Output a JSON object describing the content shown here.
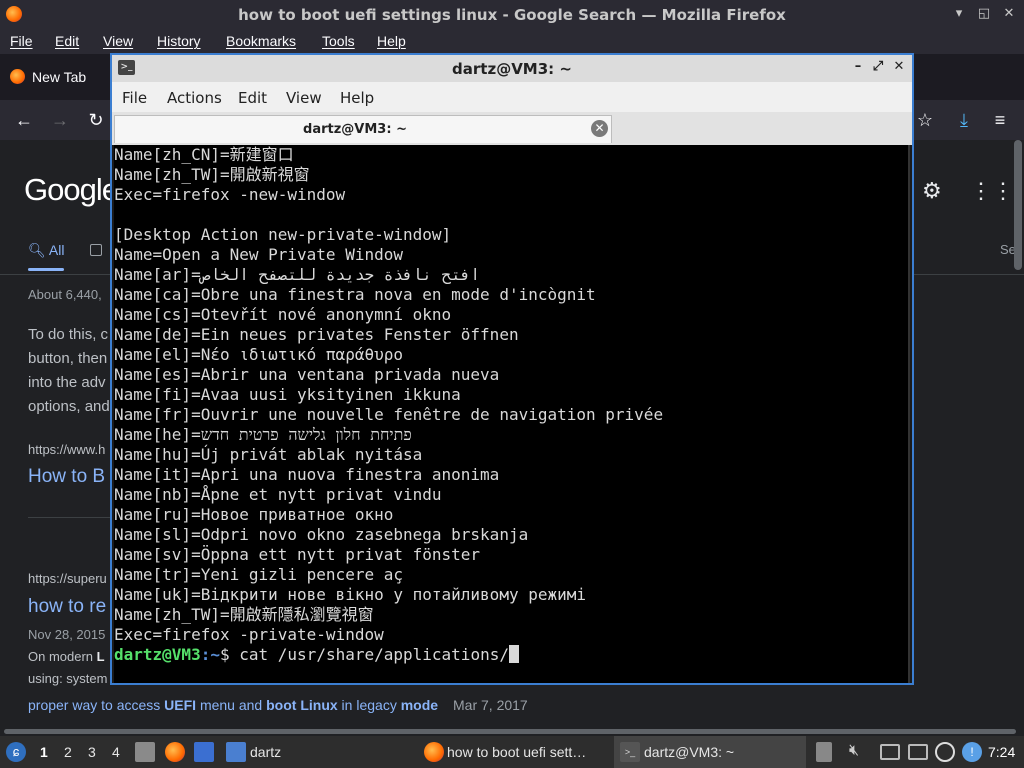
{
  "firefox": {
    "window_title": "how to boot uefi settings linux - Google Search — Mozilla Firefox",
    "menu": [
      "File",
      "Edit",
      "View",
      "History",
      "Bookmarks",
      "Tools",
      "Help"
    ],
    "tab_label": "New Tab"
  },
  "google": {
    "logo": "Google",
    "tab_all": "All",
    "tab_cut": "Se",
    "about": "About 6,440,",
    "snippet_lines": [
      "To do this, c",
      "button, then",
      "into the adv",
      "options, and"
    ],
    "result1_url": "https://www.h",
    "result1_title": "How to B",
    "result2_url": "https://superu",
    "result2_title": "how to re",
    "result2_date": "Nov 28, 2015",
    "result2_line1_pre": "On modern ",
    "result2_line1_bold": "L",
    "result2_line2": "using: system",
    "related_pre": "proper way to access ",
    "related_b1": "UEFI",
    "related_mid1": " menu and ",
    "related_b2": "boot Linux",
    "related_mid2": " in legacy ",
    "related_b3": "mode",
    "related_date": "Mar 7, 2017"
  },
  "terminal": {
    "title": "dartz@VM3: ~",
    "menu": [
      "File",
      "Actions",
      "Edit",
      "View",
      "Help"
    ],
    "tab_label": "dartz@VM3: ~",
    "lines": [
      "Name[zh_CN]=新建窗口",
      "Name[zh_TW]=開啟新視窗",
      "Exec=firefox -new-window",
      "",
      "[Desktop Action new-private-window]",
      "Name=Open a New Private Window",
      "Name[ar]=افتح نافذة جديدة للتصفح الخاص",
      "Name[ca]=Obre una finestra nova en mode d'incògnit",
      "Name[cs]=Otevřít nové anonymní okno",
      "Name[de]=Ein neues privates Fenster öffnen",
      "Name[el]=Νέο ιδιωτικό παράθυρο",
      "Name[es]=Abrir una ventana privada nueva",
      "Name[fi]=Avaa uusi yksityinen ikkuna",
      "Name[fr]=Ouvrir une nouvelle fenêtre de navigation privée",
      "Name[he]=פתיחת חלון גלישה פרטית חדש",
      "Name[hu]=Új privát ablak nyitása",
      "Name[it]=Apri una nuova finestra anonima",
      "Name[nb]=Åpne et nytt privat vindu",
      "Name[ru]=Новое приватное окно",
      "Name[sl]=Odpri novo okno zasebnega brskanja",
      "Name[sv]=Öppna ett nytt privat fönster",
      "Name[tr]=Yeni gizli pencere aç",
      "Name[uk]=Відкрити нове вікно у потайливому режимі",
      "Name[zh_TW]=開啟新隱私瀏覽視窗",
      "Exec=firefox -private-window"
    ],
    "prompt_user": "dartz@VM3",
    "prompt_sep": ":",
    "prompt_path": "~",
    "prompt_dollar": "$ ",
    "command": "cat /usr/share/applications/"
  },
  "taskbar": {
    "workspaces": [
      "1",
      "2",
      "3",
      "4"
    ],
    "folder_label": "dartz",
    "firefox_task": "how to boot uefi sett…",
    "terminal_task": "dartz@VM3: ~",
    "clock": "7:24"
  }
}
